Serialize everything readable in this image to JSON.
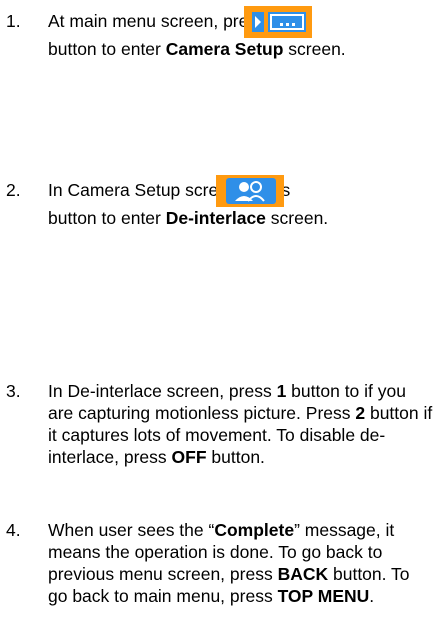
{
  "steps": [
    {
      "number": "1.",
      "line1_text": "At main menu screen, press the",
      "line2_pre": "button to enter ",
      "line2_bold": "Camera Setup",
      "line2_post": " screen.",
      "icon": "camera-menu-icon"
    },
    {
      "number": "2.",
      "line1_text": "In Camera Setup screen, press",
      "line2_pre": "button to enter ",
      "line2_bold": "De-interlace",
      "line2_post": " screen.",
      "icon": "camera-setup-icon"
    },
    {
      "number": "3.",
      "t1": "In De-interlace screen, press ",
      "b1": "1",
      "t2": " button to if you are capturing motionless picture. Press ",
      "b2": "2",
      "t3": " button if it captures lots of movement. To disable de-interlace, press ",
      "b3": "OFF",
      "t4": " button."
    },
    {
      "number": "4.",
      "t1": "When user sees the “",
      "b1": "Complete",
      "t2": "” message, it means the operation is done. To go back to previous menu screen, press ",
      "b2": "BACK",
      "t3": " button. To go back to main menu, press ",
      "b3": "TOP MENU",
      "t4": "."
    }
  ],
  "colors": {
    "button_orange": "#ff9a10",
    "icon_blue": "#2f8fe8",
    "icon_white": "#ffffff"
  }
}
